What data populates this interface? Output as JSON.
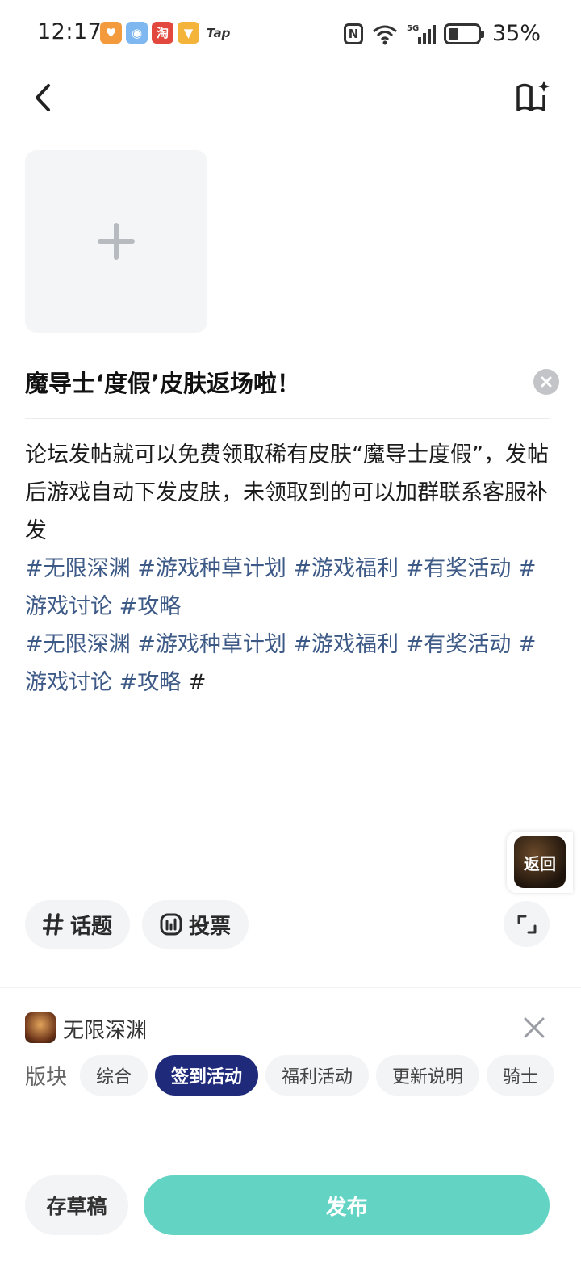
{
  "status_bar": {
    "time": "12:17",
    "battery_percent": "35%",
    "battery_level": 0.35,
    "app_icons": [
      "gift-app-icon",
      "game-app-icon",
      "taobao-icon",
      "paint-app-icon"
    ],
    "tap_label": "Tap",
    "nfc_label": "N",
    "network_label": "5G"
  },
  "post": {
    "title": "魔导士‘度假’皮肤返场啦！",
    "body": "论坛发帖就可以免费领取稀有皮肤“魔导士度假”，发帖后游戏自动下发皮肤，未领取到的可以加群联系客服补发",
    "tags_line1": [
      "#无限深渊",
      "#游戏种草计划",
      "#游戏福利",
      "#有奖活动",
      "#游戏讨论",
      "#攻略"
    ],
    "tags_line2": [
      "#无限深渊",
      "#游戏种草计划",
      "#游戏福利",
      "#有奖活动",
      "#游戏讨论",
      "#攻略"
    ],
    "trailing_hash": "#"
  },
  "float_return": {
    "label": "返回"
  },
  "toolbar": {
    "topic_label": "话题",
    "vote_label": "投票"
  },
  "game": {
    "name": "无限深渊"
  },
  "sections": {
    "label": "版块",
    "items": [
      "综合",
      "签到活动",
      "福利活动",
      "更新说明",
      "骑士"
    ],
    "active_index": 1
  },
  "bottom": {
    "draft_label": "存草稿",
    "publish_label": "发布"
  },
  "colors": {
    "tag": "#3d5a87",
    "active_section": "#1f2a7a",
    "publish": "#63d4c4"
  }
}
